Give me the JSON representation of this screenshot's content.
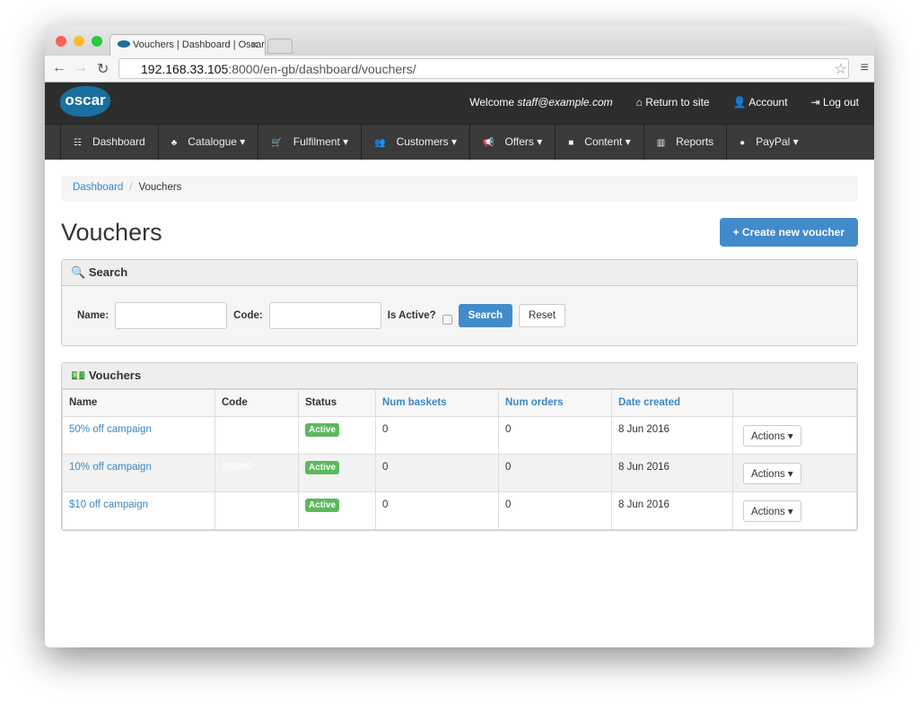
{
  "browser": {
    "tab_title": "Vouchers | Dashboard | Oscar",
    "url_host": "192.168.33.105",
    "url_path": ":8000/en-gb/dashboard/vouchers/"
  },
  "header": {
    "logo": "oscar",
    "welcome": "Welcome",
    "user": "staff@example.com",
    "return": "Return to site",
    "account": "Account",
    "logout": "Log out"
  },
  "nav": [
    {
      "label": "Dashboard",
      "icon": "☷"
    },
    {
      "label": "Catalogue ▾",
      "icon": "♣"
    },
    {
      "label": "Fulfilment ▾",
      "icon": "🛒"
    },
    {
      "label": "Customers ▾",
      "icon": "👥"
    },
    {
      "label": "Offers ▾",
      "icon": "📢"
    },
    {
      "label": "Content ▾",
      "icon": "■"
    },
    {
      "label": "Reports",
      "icon": "▥"
    },
    {
      "label": "PayPal ▾",
      "icon": "●"
    }
  ],
  "breadcrumb": {
    "home": "Dashboard",
    "current": "Vouchers"
  },
  "title": "Vouchers",
  "create_button": "+ Create new voucher",
  "search": {
    "title": "Search",
    "name_label": "Name:",
    "code_label": "Code:",
    "active_label": "Is Active?",
    "search_button": "Search",
    "reset_button": "Reset"
  },
  "vouchers": {
    "title": "Vouchers",
    "columns": [
      "Name",
      "Code",
      "Status",
      "Num baskets",
      "Num orders",
      "Date created",
      ""
    ],
    "rows": [
      {
        "name": "50% off campaign",
        "code": "",
        "status": "Active",
        "baskets": "0",
        "orders": "0",
        "date": "8 Jun 2016",
        "action": "Actions ▾"
      },
      {
        "name": "10% off campaign",
        "code": "999999",
        "status": "Active",
        "baskets": "0",
        "orders": "0",
        "date": "8 Jun 2016",
        "action": "Actions ▾"
      },
      {
        "name": "$10 off campaign",
        "code": "",
        "status": "Active",
        "baskets": "0",
        "orders": "0",
        "date": "8 Jun 2016",
        "action": "Actions ▾"
      }
    ]
  }
}
